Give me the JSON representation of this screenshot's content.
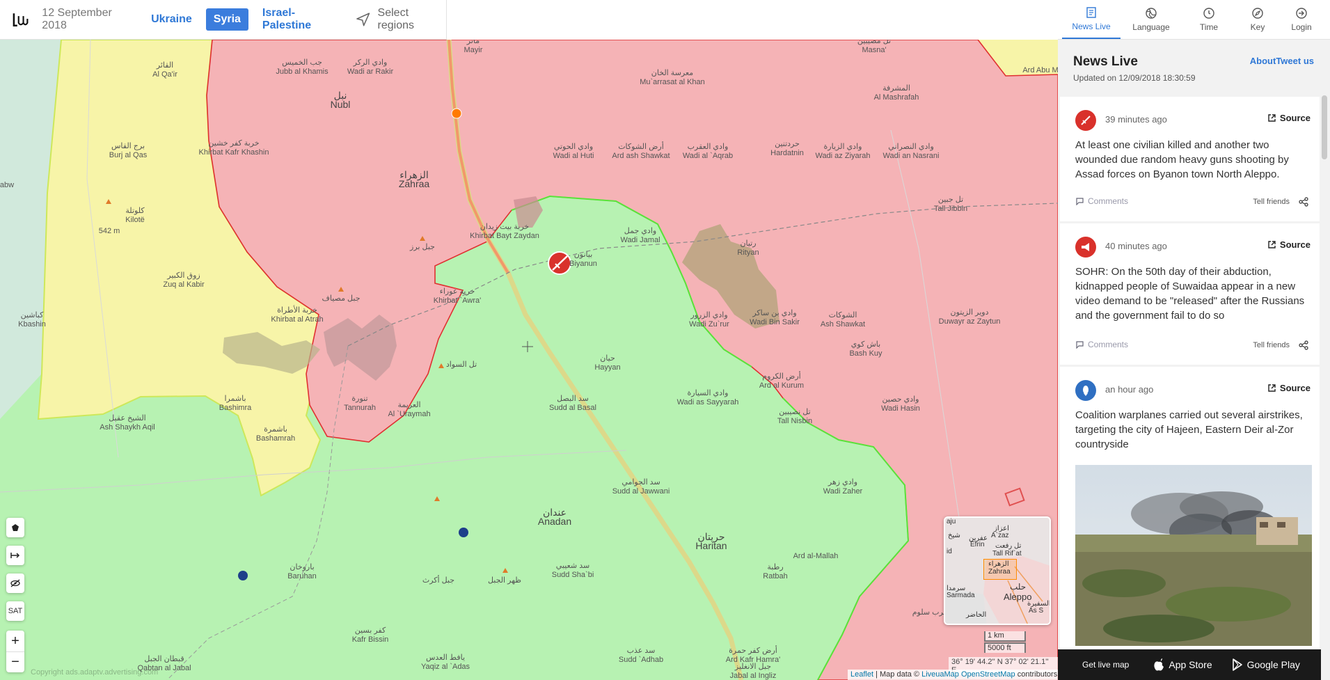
{
  "topbar": {
    "date": "12 September 2018",
    "regions": [
      "Ukraine",
      "Syria",
      "Israel-Palestine"
    ],
    "active_region": "Syria",
    "select_regions_label": "Select regions"
  },
  "nav": {
    "items": [
      {
        "label": "News Live",
        "icon": "news-icon"
      },
      {
        "label": "Language",
        "icon": "globe-icon"
      },
      {
        "label": "Time",
        "icon": "clock-icon"
      },
      {
        "label": "Key",
        "icon": "compass-icon"
      },
      {
        "label": "Login",
        "icon": "login-icon"
      }
    ],
    "active": "News Live"
  },
  "panel": {
    "title": "News Live",
    "updated": "Updated on 12/09/2018 18:30:59",
    "about_label": "About",
    "tweet_label": "Tweet us"
  },
  "news": [
    {
      "time": "39 minutes ago",
      "source_label": "Source",
      "text": "At least one civilian killed and another two wounded due random heavy guns shooting by Assad forces on Byanon town North Aleppo.",
      "comments_label": "Comments",
      "tell_label": "Tell friends",
      "icon": "rifle-icon",
      "icon_color": "#d9312b"
    },
    {
      "time": "40 minutes ago",
      "source_label": "Source",
      "text": "SOHR: On the 50th day of their abduction, kidnapped people of Suwaidaa appear in a new video demand to be \"released\" after the Russians and the government fail to do so",
      "comments_label": "Comments",
      "tell_label": "Tell friends",
      "icon": "megaphone-icon",
      "icon_color": "#d9312b"
    },
    {
      "time": "an hour ago",
      "source_label": "Source",
      "text": "Coalition warplanes carried out several airstrikes, targeting the city of Hajeen, Eastern Deir al-Zor countryside",
      "icon": "bomb-icon",
      "icon_color": "#2f6fc2"
    }
  ],
  "appbar": {
    "live_map": "Get live map",
    "app_store": "App Store",
    "google_play": "Google Play"
  },
  "map": {
    "labels": [
      {
        "ar": "القائر",
        "en": "Al Qa'ir"
      },
      {
        "ar": "جب الخميس",
        "en": "Jubb al Khamis"
      },
      {
        "ar": "وادي الركر",
        "en": "Wadi ar Rakir"
      },
      {
        "ar": "نبل",
        "en": "Nubl"
      },
      {
        "ar": "مائر",
        "en": "Mayir"
      },
      {
        "ar": "معرسة الخان",
        "en": "Mu`arrasat al Khan"
      },
      {
        "ar": "تل مصيبين",
        "en": "Masna'"
      },
      {
        "ar": "المشرفة",
        "en": "Al Mashrafah"
      },
      {
        "ar": "برج القاس",
        "en": "Burj al Qas"
      },
      {
        "ar": "خربة كفر خشين",
        "en": "Khirbat Kafr Khashin"
      },
      {
        "ar": "الزهراء",
        "en": "Zahraa"
      },
      {
        "ar": "وادي الحوتي",
        "en": "Wadi al Huti"
      },
      {
        "ar": "أرض الشوكات",
        "en": "Ard ash Shawkat"
      },
      {
        "ar": "وادي العقرب",
        "en": "Wadi al `Aqrab"
      },
      {
        "ar": "حردتنين",
        "en": "Hardatnin"
      },
      {
        "ar": "وادي الزيارة",
        "en": "Wadi az Ziyarah"
      },
      {
        "ar": "وادي النصراني",
        "en": "Wadi an Nasrani"
      },
      {
        "ar": "كلوتلة",
        "en": "Kilotë"
      },
      {
        "ar": "",
        "en": "542 m"
      },
      {
        "ar": "خربة بيت زيدان",
        "en": "Khirbat Bayt Zaydan"
      },
      {
        "ar": "جبل برز",
        "en": ""
      },
      {
        "ar": "وادي جمل",
        "en": "Wadi Jamal"
      },
      {
        "ar": "رتيان",
        "en": "Rityan"
      },
      {
        "ar": "تل جبين",
        "en": "Tall Jibbin"
      },
      {
        "ar": "بيانون",
        "en": "Biyanun"
      },
      {
        "ar": "زوق الكبير",
        "en": "Zuq al Kabir"
      },
      {
        "ar": "خربة عوراء",
        "en": "Khirbat `Awra'"
      },
      {
        "ar": "جبل مصياف",
        "en": ""
      },
      {
        "ar": "كباشين",
        "en": "Kbashin"
      },
      {
        "ar": "خربة الأطراة",
        "en": "Khirbat al Atrah"
      },
      {
        "ar": "وادي الزرور",
        "en": "Wadi Zu`rur"
      },
      {
        "ar": "وادي بن ساكر",
        "en": "Wadi Bin Sakir"
      },
      {
        "ar": "الشوكات",
        "en": "Ash Shawkat"
      },
      {
        "ar": "دوير الزيتون",
        "en": "Duwayr az Zaytun"
      },
      {
        "ar": "باش كوي",
        "en": "Bash Kuy"
      },
      {
        "ar": "حيان",
        "en": "Hayyan"
      },
      {
        "ar": "تل السواد",
        "en": ""
      },
      {
        "ar": "أرض الكروم",
        "en": "Ard al Kurum"
      },
      {
        "ar": "باشمرا",
        "en": "Bashimra"
      },
      {
        "ar": "تنورة",
        "en": "Tannurah"
      },
      {
        "ar": "العريمة",
        "en": "Al `Uraymah"
      },
      {
        "ar": "سد البصل",
        "en": "Sudd al Basal"
      },
      {
        "ar": "وادي السيارة",
        "en": "Wadi as Sayyarah"
      },
      {
        "ar": "تل نصيبين",
        "en": "Tall Nisbin"
      },
      {
        "ar": "وادي حصين",
        "en": "Wadi Hasin"
      },
      {
        "ar": "الشيخ عقيل",
        "en": "Ash Shaykh Aqil"
      },
      {
        "ar": "باشمرة",
        "en": "Bashamrah"
      },
      {
        "ar": "سد الجوامي",
        "en": "Sudd al Jawwani"
      },
      {
        "ar": "وادي زهر",
        "en": "Wadi Zaher"
      },
      {
        "ar": "عندان",
        "en": "Anadan"
      },
      {
        "ar": "حريتان",
        "en": "Haritan"
      },
      {
        "ar": "باروخان",
        "en": "Baruhan"
      },
      {
        "ar": "سد شعيبي",
        "en": "Sudd Sha`bi"
      },
      {
        "ar": "رطبة",
        "en": "Ratbah"
      },
      {
        "ar": "",
        "en": "Ard al-Mallah"
      },
      {
        "ar": "جبل أكرث",
        "en": ""
      },
      {
        "ar": "ظهر الجبل",
        "en": ""
      },
      {
        "ar": "كفر بسين",
        "en": "Kafr Bissin"
      },
      {
        "ar": "يافط العدس",
        "en": "Yaqiz al `Adas"
      },
      {
        "ar": "سد عذب",
        "en": "Sudd `Adhab"
      },
      {
        "ar": "أرض كفر حمرة",
        "en": "Ard Kafr Hamra'"
      },
      {
        "ar": "قبطان الجبل",
        "en": "Qabtan al Jabal"
      },
      {
        "ar": "جبل الانغليز",
        "en": "Jabal al Ingliz"
      },
      {
        "ar": "غرب سلوم",
        "en": ""
      },
      {
        "ar": "",
        "en": "Ard Abu M"
      },
      {
        "ar": "",
        "en": "abw"
      }
    ],
    "minimap_labels": [
      "اعزاز",
      "A`zaz",
      "شيخ",
      "عفرين",
      "Efrin",
      "تل رفعت",
      "Tall Rif`at",
      "الزهراء",
      "Zahraa",
      "سرمدا",
      "Sarmada",
      "حلب",
      "Aleppo",
      "السفيرة",
      "As S",
      "الحاضر",
      "id",
      "aju"
    ],
    "controls": {
      "sat_label": "SAT",
      "zoom_in": "+",
      "zoom_out": "−"
    },
    "scale": {
      "metric": "1 km",
      "imperial": "5000 ft"
    },
    "coords": "36° 19' 44.2'' N 37° 02' 21.1'' E",
    "attribution": {
      "leaflet": "Leaflet",
      "sep": "| Map data ©",
      "liveuamap": "LiveuaMap",
      "osm": "OpenStreetMap",
      "contributors": "contributors"
    },
    "watermark": "Copyright ads.adaptv.advertising.com"
  },
  "colors": {
    "regime": "#f5b3b6",
    "rebel": "#b7f2b2",
    "kurdish": "#f7f4a8",
    "accent": "#2f78d6",
    "red_border": "#e03030"
  }
}
